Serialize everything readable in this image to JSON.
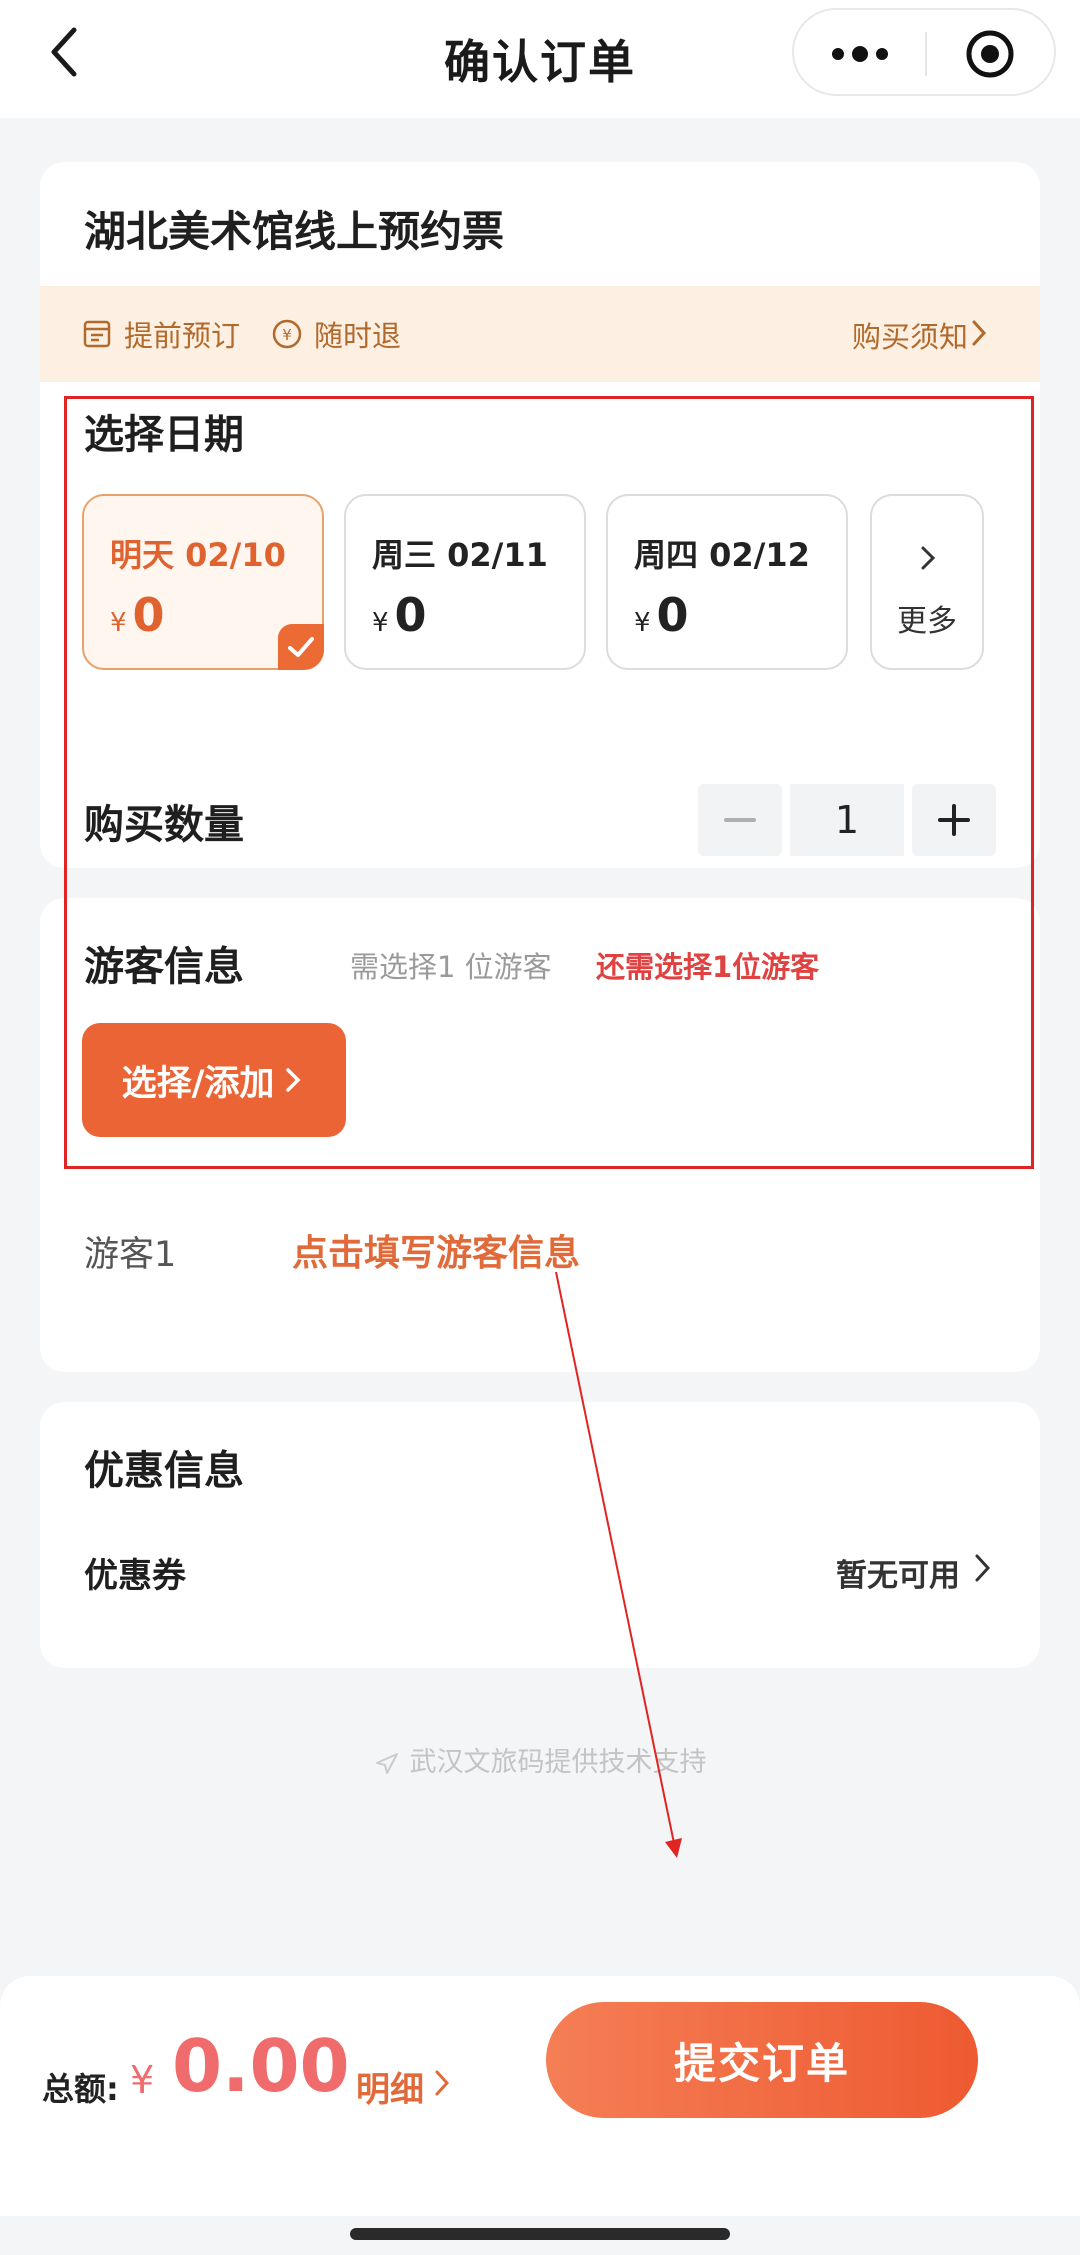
{
  "nav": {
    "title": "确认订单"
  },
  "ticket": {
    "title": "湖北美术馆线上预约票",
    "tags": [
      "提前预订",
      "随时退"
    ],
    "notice_link": "购买须知"
  },
  "date_section": {
    "title": "选择日期",
    "dates": [
      {
        "label": "明天 02/10",
        "currency": "¥",
        "price": "0",
        "selected": true
      },
      {
        "label": "周三 02/11",
        "currency": "¥",
        "price": "0",
        "selected": false
      },
      {
        "label": "周四 02/12",
        "currency": "¥",
        "price": "0",
        "selected": false
      }
    ],
    "more_label": "更多"
  },
  "quantity": {
    "label": "购买数量",
    "value": "1"
  },
  "visitor": {
    "title": "游客信息",
    "hint": "需选择1 位游客",
    "warning": "还需选择1位游客",
    "add_button": "选择/添加",
    "visitor_label": "游客1",
    "fill_link": "点击填写游客信息"
  },
  "coupon": {
    "title": "优惠信息",
    "label": "优惠券",
    "value": "暂无可用"
  },
  "support_text": "武汉文旅码提供技术支持",
  "footer": {
    "total_label": "总额:",
    "currency": "¥",
    "amount": "0.00",
    "detail_link": "明细",
    "submit": "提交订单"
  },
  "colors": {
    "accent": "#ea6436",
    "warning": "#e04242",
    "notice_bg": "#fdf0e2",
    "annotation": "#e02424"
  },
  "icons": [
    "back-icon",
    "more-dots-icon",
    "target-icon",
    "calendar-icon",
    "refund-icon",
    "chevron-right-icon",
    "check-icon",
    "minus-icon",
    "plus-icon",
    "send-icon"
  ]
}
